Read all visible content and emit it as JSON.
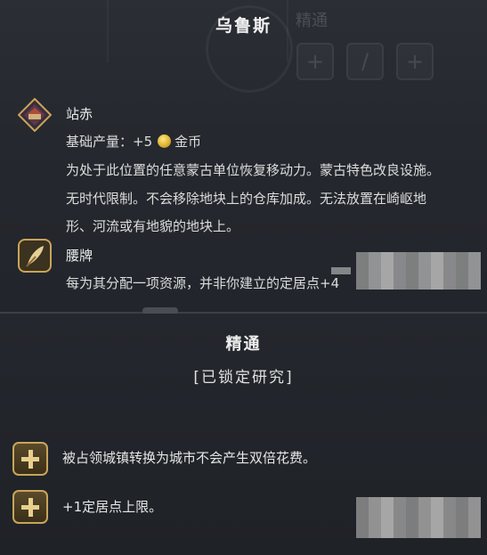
{
  "header": {
    "title": "乌鲁斯",
    "ghost_label": "精通"
  },
  "abilities": [
    {
      "icon": "yam-station-icon",
      "name": "站赤",
      "yield_prefix": "基础产量：",
      "yield_value": "+5",
      "yield_resource": "金币",
      "desc_lines": [
        "为处于此位置的任意蒙古单位恢复移动力。蒙古特色改良设施。",
        "无时代限制。不会移除地块上的仓库加成。无法放置在崎岖地",
        "形、河流或有地貌的地块上。"
      ]
    },
    {
      "icon": "paiza-icon",
      "name": "腰牌",
      "desc_lines": [
        "每为其分配一项资源，并非你建立的定居点+4"
      ]
    }
  ],
  "mastery": {
    "title": "精通",
    "status": "[已锁定研究]",
    "items": [
      {
        "icon": "plus-icon",
        "text": "被占领城镇转换为城市不会产生双倍花费。"
      },
      {
        "icon": "plus-icon",
        "text": "+1定居点上限。"
      }
    ]
  },
  "colors": {
    "accent_gold": "#c9a45a",
    "coin_gold": "#e0b233",
    "panel_bg": "#25282e"
  }
}
